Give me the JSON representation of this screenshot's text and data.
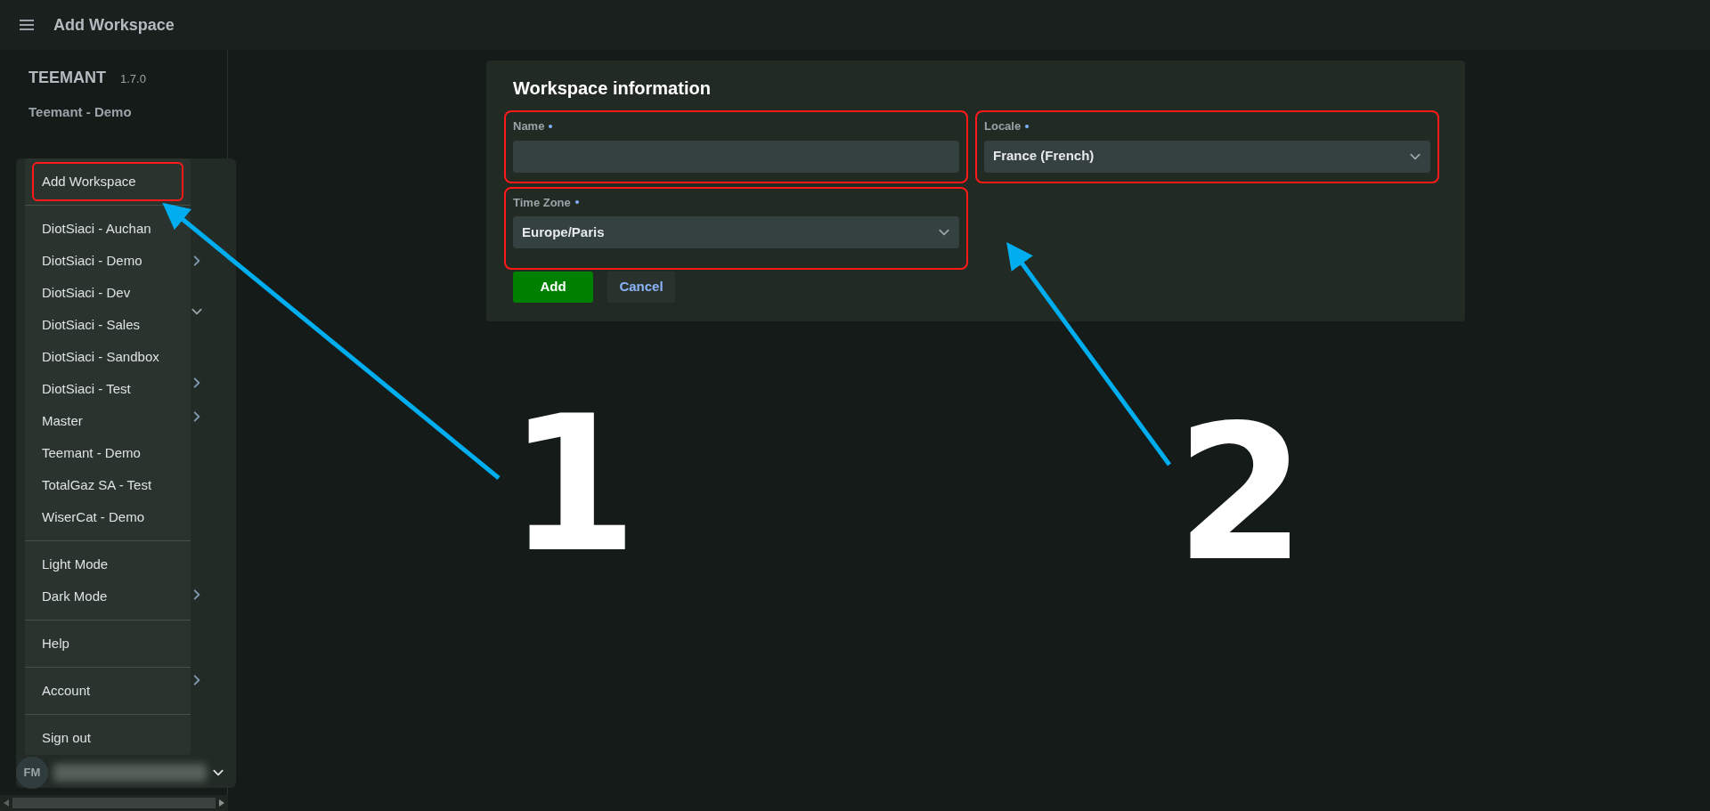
{
  "top_bar": {
    "title": "Add Workspace"
  },
  "sidebar": {
    "app_name": "TEEMANT",
    "version": "1.7.0",
    "workspace": "Teemant - Demo",
    "user": {
      "initials": "FM"
    }
  },
  "menu": {
    "sections": [
      [
        {
          "label": "Add Workspace",
          "annotated": true
        }
      ],
      [
        {
          "label": "DiotSiaci - Auchan",
          "annotated": false
        },
        {
          "label": "DiotSiaci - Demo",
          "annotated": false
        },
        {
          "label": "DiotSiaci - Dev",
          "annotated": false
        },
        {
          "label": "DiotSiaci - Sales",
          "annotated": false
        },
        {
          "label": "DiotSiaci - Sandbox",
          "annotated": false
        },
        {
          "label": "DiotSiaci - Test",
          "annotated": false
        },
        {
          "label": "Master",
          "annotated": false
        },
        {
          "label": "Teemant - Demo",
          "annotated": false
        },
        {
          "label": "TotalGaz SA - Test",
          "annotated": false
        },
        {
          "label": "WiserCat - Demo",
          "annotated": false
        }
      ],
      [
        {
          "label": "Light Mode",
          "annotated": false
        },
        {
          "label": "Dark Mode",
          "annotated": false
        }
      ],
      [
        {
          "label": "Help",
          "annotated": false
        }
      ],
      [
        {
          "label": "Account",
          "annotated": false
        }
      ],
      [
        {
          "label": "Sign out",
          "annotated": false
        }
      ]
    ]
  },
  "form": {
    "title": "Workspace information",
    "fields": [
      {
        "kind": "text",
        "label": "Name",
        "required": true,
        "annotated": true
      },
      {
        "kind": "select",
        "label": "Locale",
        "required": true,
        "value": "France (French)",
        "annotated": true
      },
      {
        "kind": "select",
        "label": "Time Zone",
        "required": true,
        "value": "Europe/Paris",
        "annotated": true
      }
    ],
    "buttons": [
      {
        "kind": "primary",
        "label": "Add"
      },
      {
        "kind": "secondary",
        "label": "Cancel"
      }
    ]
  },
  "annotations": [
    {
      "number": "1"
    },
    {
      "number": "2"
    }
  ]
}
